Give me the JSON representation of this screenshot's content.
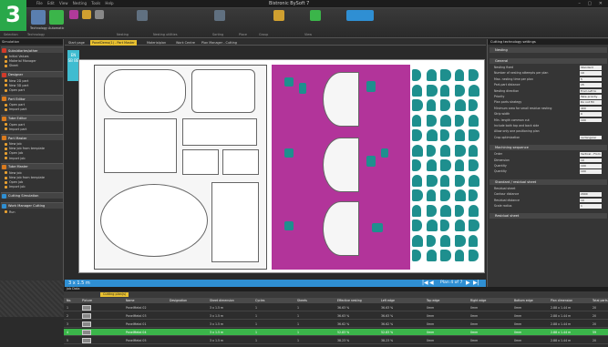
{
  "badge": "3",
  "window": {
    "title": "Bistronic BySoft 7"
  },
  "ribbon": {
    "groups": [
      "Selection",
      "Technology",
      "Nesting",
      "Nesting utilities",
      "Sorting",
      "Place",
      "Group",
      "View"
    ],
    "buttons": [
      "Technology",
      "Automatic",
      "Add Interior",
      "Move",
      "Rotate",
      "Optimize",
      "Next"
    ]
  },
  "left_panel": {
    "title": "Simulation",
    "sections": [
      {
        "label": "Subsidiaries/other",
        "color": "#d23a2a",
        "items": [
          "Initial Values",
          "Material Manager",
          "Sheet"
        ]
      },
      {
        "label": "Designer",
        "color": "#d23a2a",
        "items": [
          "New 2D part",
          "New 3D part",
          "Open part"
        ]
      },
      {
        "label": "Part Editor",
        "color": "#d97a1e",
        "items": [
          "Open part",
          "Import part"
        ]
      },
      {
        "label": "Tube Editor",
        "color": "#d97a1e",
        "items": [
          "Open part",
          "Import part"
        ]
      },
      {
        "label": "Part Master",
        "color": "#d97a1e",
        "items": [
          "New job",
          "New job from template",
          "Open job",
          "Import job"
        ]
      },
      {
        "label": "Tube Master",
        "color": "#d97a1e",
        "items": [
          "New job",
          "New job from template",
          "Open job",
          "Import job"
        ]
      },
      {
        "label": "Cutting Simulation",
        "color": "#2f8fd3",
        "items": []
      },
      {
        "label": "Work Manager Cutting",
        "color": "#2f8fd3",
        "items": [
          "Run"
        ]
      }
    ]
  },
  "tabs": [
    "Start page",
    "PanelDemo(1) - Part Master",
    "Materialplan",
    "Work Centre",
    "Plan Manager - Cutting"
  ],
  "canvas": {
    "zoom_label": "EN",
    "zoom_value": "SB BE",
    "sheet_size": "3 x 1.5 m",
    "plan_label": "Plan 4 of 7"
  },
  "colors": {
    "magenta": "#b2349a",
    "teal": "#1e8f8e",
    "accent_green": "#3bb54a",
    "accent_blue": "#2f8fd3"
  },
  "right_panel": {
    "title": "Cutting technology settings",
    "sections": [
      {
        "label": "Nesting",
        "rows": []
      },
      {
        "label": "General",
        "rows": [
          {
            "label": "Nesting fixed",
            "value": "Standard"
          },
          {
            "label": "Number of nesting attempts per plan",
            "value": "10"
          },
          {
            "label": "Max. nesting time per plan",
            "value": "5"
          },
          {
            "label": "Part-part distance",
            "value": "15"
          },
          {
            "label": "Nesting direction",
            "value": "From left to right"
          },
          {
            "label": "Priority",
            "value": "Take priority"
          },
          {
            "label": "Plan parts strategy",
            "value": "Do not fill sheet"
          },
          {
            "label": "Minimum area for small residue nesting",
            "value": "400"
          },
          {
            "label": "Strip width",
            "value": "0"
          },
          {
            "label": "Min. length common cut",
            "value": "100"
          },
          {
            "label": "Include both top and back side",
            "value": ""
          },
          {
            "label": "Allow only one positioning plan",
            "value": ""
          },
          {
            "label": "Crop optimization",
            "value": "rectangular"
          }
        ]
      },
      {
        "label": "Machining sequence",
        "rows": [
          {
            "label": "Order",
            "value": "Vertical - From left to right"
          },
          {
            "label": "Dimension",
            "value": "10"
          },
          {
            "label": "Quantity",
            "value": "100"
          },
          {
            "label": "Quantity",
            "value": "100"
          }
        ]
      },
      {
        "label": "Standard / residual sheet",
        "rows": [
          {
            "label": "Residual sheet",
            "value": ""
          },
          {
            "label": "Contour distance",
            "value": "2900"
          },
          {
            "label": "Residual distance",
            "value": "10"
          },
          {
            "label": "Scale radius",
            "value": "1"
          }
        ]
      },
      {
        "label": "Residual sheet",
        "rows": []
      }
    ]
  },
  "job_list": {
    "title": "Job Data",
    "tab_label": "Cutting plan(s)",
    "columns": [
      "No.",
      "Picture",
      "Name",
      "Designation",
      "Sheet dimension",
      "Cycles",
      "Sheets",
      "Effective nesting",
      "Left edge",
      "Top edge",
      "Right edge",
      "Bottom edge",
      "Plan dimension",
      "Total parts"
    ],
    "rows": [
      {
        "no": "1",
        "name": "PanelMetal 02",
        "sheet": "3 x 1.5 m",
        "cycles": "1",
        "sheets": "1",
        "eff": "36.63 %",
        "left": "36.63 %",
        "top": "0mm",
        "right": "0mm",
        "bottom": "0mm",
        "plan": "2.88 x 1.44 m",
        "total": "20",
        "selected": false
      },
      {
        "no": "2",
        "name": "PanelMetal 03",
        "sheet": "3 x 1.5 m",
        "cycles": "1",
        "sheets": "1",
        "eff": "36.63 %",
        "left": "36.63 %",
        "top": "0mm",
        "right": "0mm",
        "bottom": "0mm",
        "plan": "2.88 x 1.44 m",
        "total": "20",
        "selected": false
      },
      {
        "no": "3",
        "name": "PanelMetal 01",
        "sheet": "3 x 1.5 m",
        "cycles": "1",
        "sheets": "1",
        "eff": "36.62 %",
        "left": "36.62 %",
        "top": "0mm",
        "right": "0mm",
        "bottom": "0mm",
        "plan": "2.88 x 1.44 m",
        "total": "20",
        "selected": false
      },
      {
        "no": "4",
        "name": "PanelMetal 04",
        "sheet": "3 x 1.5 m",
        "cycles": "1",
        "sheets": "1",
        "eff": "52.83 %",
        "left": "52.83 %",
        "top": "0mm",
        "right": "0mm",
        "bottom": "0mm",
        "plan": "2.88 x 1.44 m",
        "total": "59",
        "selected": true
      },
      {
        "no": "5",
        "name": "PanelMetal 05",
        "sheet": "3 x 1.5 m",
        "cycles": "1",
        "sheets": "1",
        "eff": "38.23 %",
        "left": "38.23 %",
        "top": "0mm",
        "right": "0mm",
        "bottom": "0mm",
        "plan": "2.88 x 1.44 m",
        "total": "20",
        "selected": false
      }
    ]
  }
}
